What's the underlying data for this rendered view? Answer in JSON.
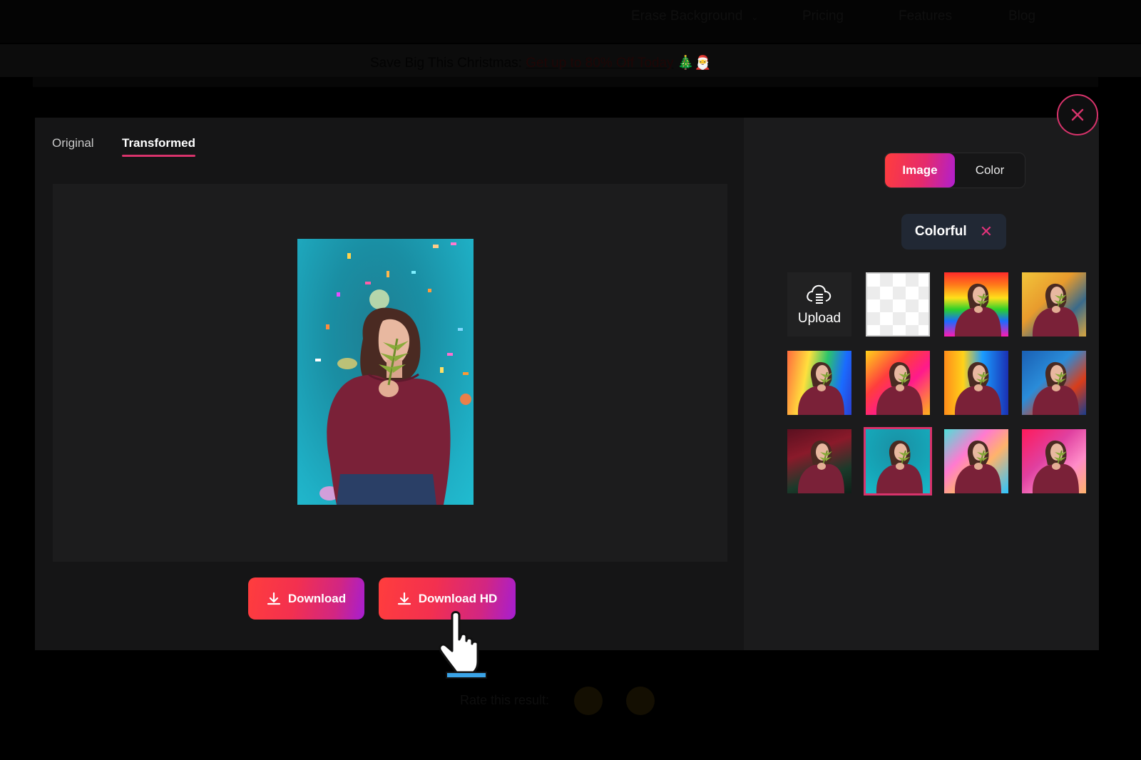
{
  "nav": {
    "items": [
      "Erase Background",
      "Pricing",
      "Features",
      "Blog"
    ],
    "dropdown_icon": "chevron-down-icon"
  },
  "promo": {
    "text": "Save Big This Christmas:",
    "link": "Get up to 80% Off Today",
    "emoji": "🎄🎅"
  },
  "modal": {
    "tabs": [
      {
        "label": "Original",
        "active": false
      },
      {
        "label": "Transformed",
        "active": true
      }
    ],
    "buttons": {
      "download": "Download",
      "download_hd": "Download HD"
    },
    "close_icon": "close-icon"
  },
  "background_panel": {
    "segments": [
      {
        "label": "Image",
        "active": true
      },
      {
        "label": "Color",
        "active": false
      }
    ],
    "category_chip": {
      "label": "Colorful",
      "remove_icon": "close-icon"
    },
    "upload_label": "Upload",
    "tiles": [
      {
        "type": "upload"
      },
      {
        "type": "transparent"
      },
      {
        "type": "background",
        "name": "rainbow-stripes"
      },
      {
        "type": "background",
        "name": "yellow-painting"
      },
      {
        "type": "background",
        "name": "rainbow-paint-swirl"
      },
      {
        "type": "background",
        "name": "red-yellow-splash"
      },
      {
        "type": "background",
        "name": "orange-blue-stripes"
      },
      {
        "type": "background",
        "name": "blue-red-abstract"
      },
      {
        "type": "background",
        "name": "dark-red-drape"
      },
      {
        "type": "background",
        "name": "teal-confetti",
        "selected": true
      },
      {
        "type": "background",
        "name": "pastel-bokeh"
      },
      {
        "type": "background",
        "name": "pink-watercolor"
      }
    ]
  },
  "rating": {
    "label": "Rate this result:"
  },
  "colors": {
    "accent": "#d8336b",
    "gradient_start": "#ff3d3d",
    "gradient_end": "#a61ed2",
    "chip_bg": "#212834"
  }
}
